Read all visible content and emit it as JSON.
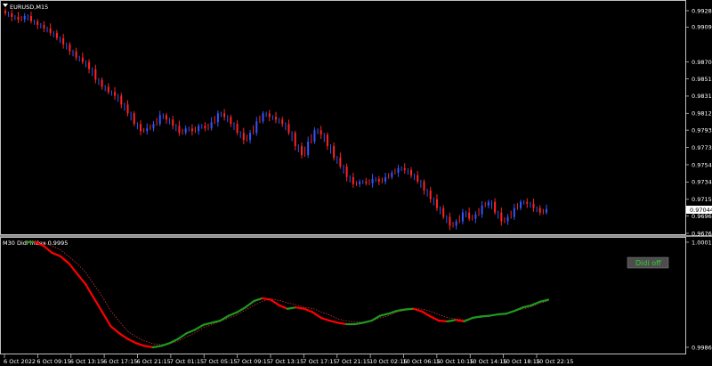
{
  "window": {
    "symbol_title": "EURUSD,M15",
    "indicator_title": "M30 Didi index 0.9995"
  },
  "button": {
    "label": "Didi off"
  },
  "colors": {
    "background": "#000000",
    "frame": "#c0c0c0",
    "candle_up": "#3355ff",
    "candle_down": "#ff2222",
    "didi_down": "#ff0000",
    "didi_up": "#1f9a1f",
    "didi_signal": "#cc3333",
    "button_bg": "#4d4d4d",
    "button_text": "#32cd32"
  },
  "icons": {
    "menu": "triangle-down-icon"
  },
  "chart_data": [
    {
      "type": "candlestick",
      "title": "EURUSD,M15",
      "price_axis": [
        "0.99280",
        "0.99095",
        "0.98700",
        "0.98510",
        "0.98315",
        "0.98120",
        "0.97930",
        "0.97735",
        "0.97540",
        "0.97345",
        "0.97150",
        "0.96960",
        "0.96765"
      ],
      "current_price": "0.97044",
      "ylim": [
        0.96765,
        0.9928
      ],
      "x_labels": [
        "6 Oct 2022",
        "6 Oct 09:15",
        "6 Oct 13:15",
        "6 Oct 17:15",
        "6 Oct 21:15",
        "7 Oct 01:15",
        "7 Oct 05:15",
        "7 Oct 09:15",
        "7 Oct 13:15",
        "7 Oct 17:15",
        "7 Oct 21:15",
        "10 Oct 02:15",
        "10 Oct 06:15",
        "10 Oct 10:15",
        "10 Oct 14:15",
        "10 Oct 18:15",
        "10 Oct 22:15"
      ],
      "close": [
        0.9925,
        0.9921,
        0.9918,
        0.9922,
        0.9916,
        0.9912,
        0.9908,
        0.9903,
        0.9897,
        0.989,
        0.9882,
        0.9875,
        0.987,
        0.9862,
        0.985,
        0.9842,
        0.9836,
        0.9832,
        0.9822,
        0.9812,
        0.98,
        0.9792,
        0.9795,
        0.98,
        0.981,
        0.9805,
        0.9798,
        0.979,
        0.9795,
        0.9792,
        0.9798,
        0.9795,
        0.9802,
        0.9812,
        0.9808,
        0.98,
        0.979,
        0.9782,
        0.979,
        0.9803,
        0.9812,
        0.9808,
        0.9805,
        0.98,
        0.979,
        0.9775,
        0.9765,
        0.978,
        0.9793,
        0.9788,
        0.9775,
        0.9762,
        0.9752,
        0.974,
        0.9732,
        0.9735,
        0.9733,
        0.9738,
        0.9735,
        0.974,
        0.9745,
        0.975,
        0.9748,
        0.9742,
        0.9735,
        0.9725,
        0.9715,
        0.9705,
        0.9695,
        0.9685,
        0.969,
        0.97,
        0.9693,
        0.9698,
        0.9708,
        0.9712,
        0.97,
        0.969,
        0.9695,
        0.9705,
        0.9712,
        0.971,
        0.9705,
        0.97,
        0.9704
      ]
    },
    {
      "type": "line",
      "title": "M30 Didi index 0.9995",
      "y_axis": [
        "1.0001",
        "0.9986"
      ],
      "ylim": [
        0.9986,
        1.0001
      ],
      "series": [
        {
          "values": [
            1.0001,
            1.0001,
            1.00005,
            0.99995,
            0.9999,
            0.9998,
            0.99965,
            0.9995,
            0.9993,
            0.9991,
            0.9989,
            0.9988,
            0.99872,
            0.99866,
            0.99862,
            0.9986,
            0.99862,
            0.99866,
            0.99872,
            0.9988,
            0.99885,
            0.99892,
            0.99895,
            0.99898,
            0.99905,
            0.9991,
            0.99917,
            0.99926,
            0.9993,
            0.99928,
            0.9992,
            0.99915,
            0.99917,
            0.99915,
            0.9991,
            0.99902,
            0.99898,
            0.99895,
            0.99893,
            0.99893,
            0.99895,
            0.99898,
            0.99905,
            0.99908,
            0.99912,
            0.99914,
            0.99915,
            0.99911,
            0.99904,
            0.99898,
            0.99897,
            0.99899,
            0.99897,
            0.99902,
            0.99904,
            0.99905,
            0.99907,
            0.99908,
            0.99912,
            0.99917,
            0.9992,
            0.99925,
            0.99928
          ]
        }
      ]
    }
  ]
}
